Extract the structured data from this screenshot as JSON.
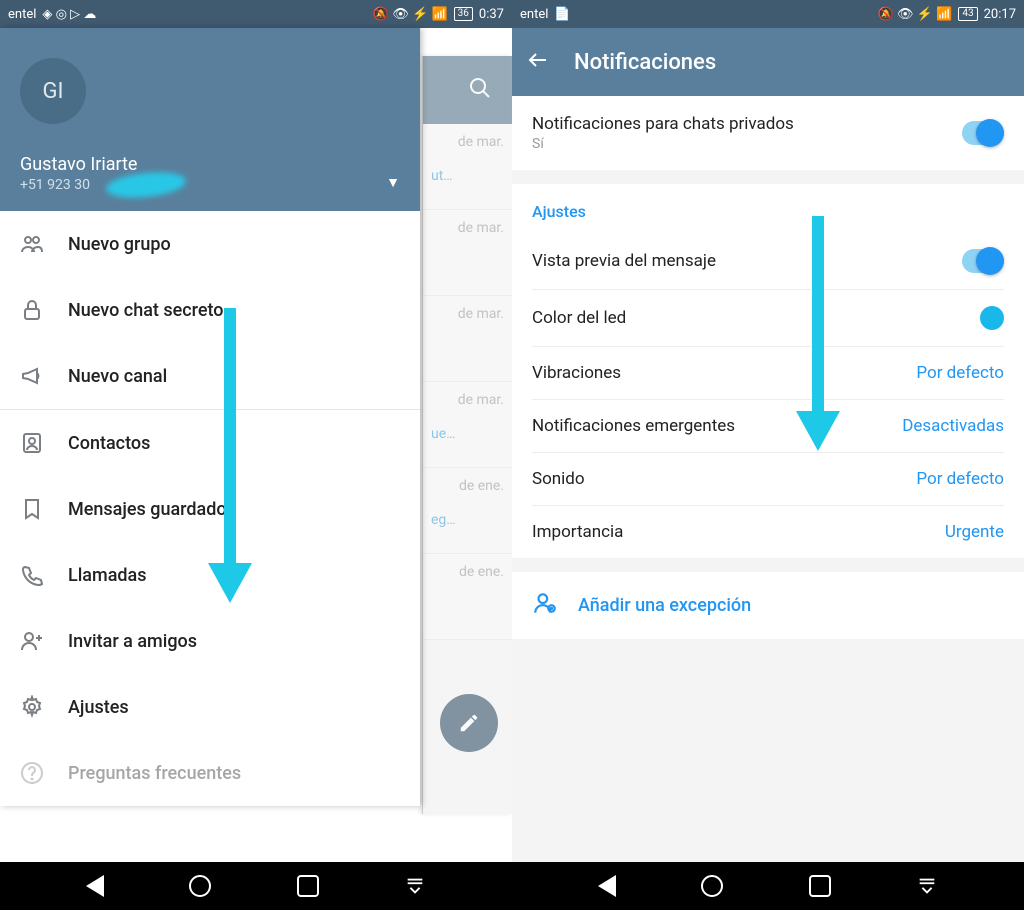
{
  "left_screen": {
    "statusbar": {
      "carrier": "entel",
      "battery": "36",
      "time": "0:37"
    },
    "user": {
      "initials": "GI",
      "name": "Gustavo Iriarte",
      "phone": "+51 923 30"
    },
    "menu": {
      "nuevo_grupo": "Nuevo grupo",
      "nuevo_chat_secreto": "Nuevo chat secreto",
      "nuevo_canal": "Nuevo canal",
      "contactos": "Contactos",
      "mensajes_guardados": "Mensajes guardados",
      "llamadas": "Llamadas",
      "invitar": "Invitar a amigos",
      "ajustes": "Ajustes",
      "faq": "Preguntas frecuentes"
    },
    "bg_chats": [
      {
        "date": "de mar.",
        "snip": "ut…"
      },
      {
        "date": "de mar.",
        "snip": ""
      },
      {
        "date": "de mar.",
        "snip": ""
      },
      {
        "date": "de mar.",
        "snip": "ue…"
      },
      {
        "date": "de ene.",
        "snip": "eg…"
      },
      {
        "date": "de ene.",
        "snip": ""
      }
    ]
  },
  "right_screen": {
    "statusbar": {
      "carrier": "entel",
      "battery": "43",
      "time": "20:17"
    },
    "appbar_title": "Notificaciones",
    "private_chats": {
      "label": "Notificaciones para chats privados",
      "sub": "Sí"
    },
    "settings_header": "Ajustes",
    "rows": {
      "preview": {
        "label": "Vista previa del mensaje"
      },
      "led": {
        "label": "Color del led"
      },
      "vibration": {
        "label": "Vibraciones",
        "value": "Por defecto"
      },
      "popup": {
        "label": "Notificaciones emergentes",
        "value": "Desactivadas"
      },
      "sound": {
        "label": "Sonido",
        "value": "Por defecto"
      },
      "importance": {
        "label": "Importancia",
        "value": "Urgente"
      }
    },
    "add_exception": "Añadir una excepción"
  }
}
